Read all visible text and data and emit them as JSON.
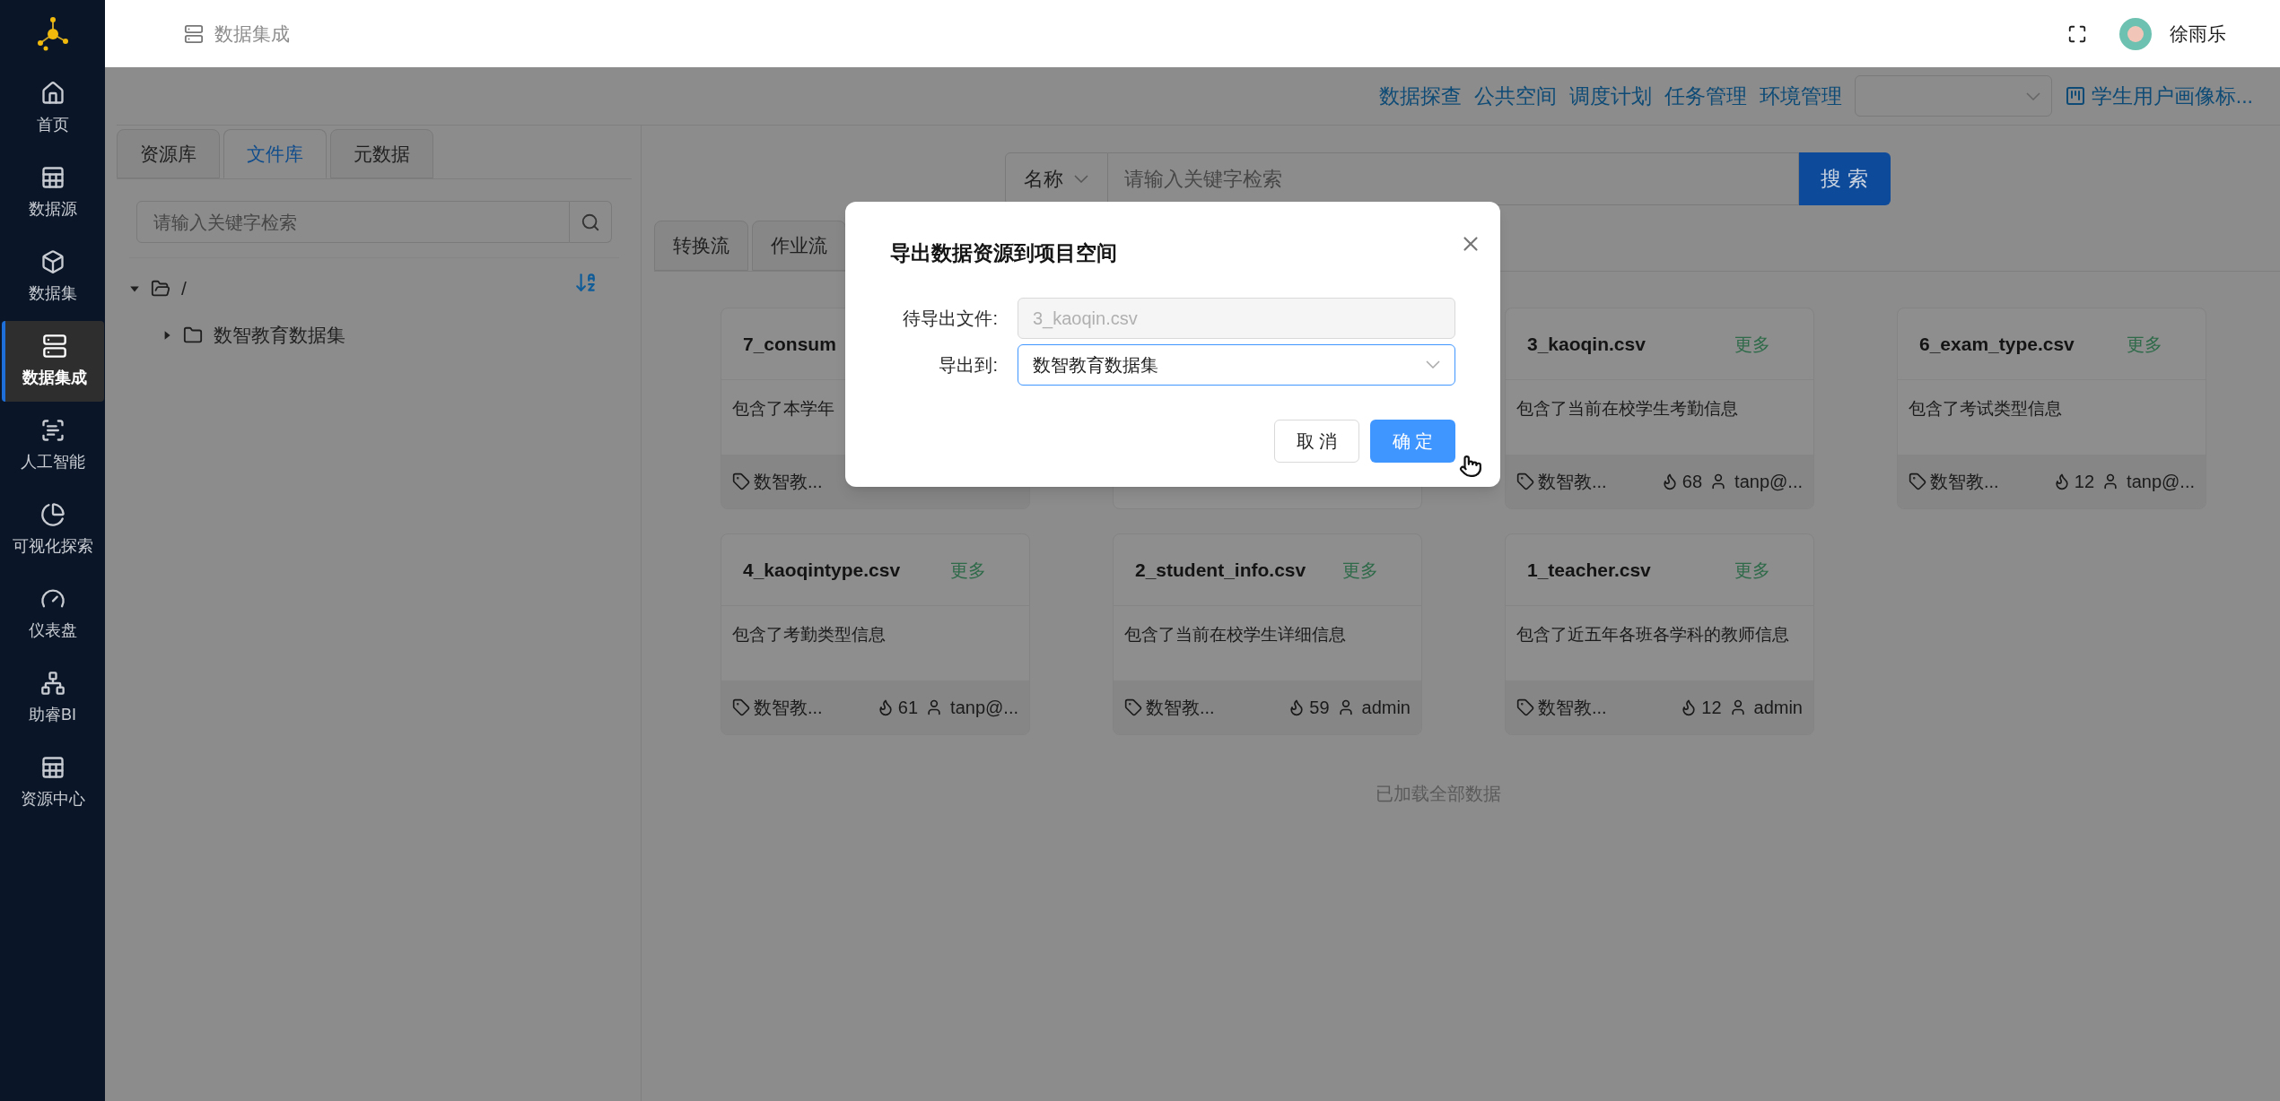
{
  "sidebar": {
    "items": [
      {
        "label": "首页",
        "selected": false
      },
      {
        "label": "数据源",
        "selected": false
      },
      {
        "label": "数据集",
        "selected": false
      },
      {
        "label": "数据集成",
        "selected": true
      },
      {
        "label": "人工智能",
        "selected": false
      },
      {
        "label": "可视化探索",
        "selected": false
      },
      {
        "label": "仪表盘",
        "selected": false
      },
      {
        "label": "助睿BI",
        "selected": false
      },
      {
        "label": "资源中心",
        "selected": false
      }
    ]
  },
  "header": {
    "breadcrumb": "数据集成",
    "user": "徐雨乐"
  },
  "toolbar": {
    "links": [
      "数据探查",
      "公共空间",
      "调度计划",
      "任务管理",
      "环境管理"
    ],
    "project": "学生用户画像标..."
  },
  "left_panel": {
    "tabs": [
      {
        "label": "资源库",
        "selected": false
      },
      {
        "label": "文件库",
        "selected": true
      },
      {
        "label": "元数据",
        "selected": false
      }
    ],
    "search": {
      "placeholder": "请输入关键字检索"
    },
    "tree": [
      {
        "label": "/",
        "expanded": true,
        "children": [
          {
            "label": "数智教育数据集",
            "expanded": false
          }
        ]
      }
    ]
  },
  "search": {
    "field": "名称",
    "placeholder": "请输入关键字检索",
    "button": "搜 索"
  },
  "flow_tabs": [
    {
      "label": "转换流",
      "selected": false
    },
    {
      "label": "作业流",
      "selected": false
    }
  ],
  "cards": [
    {
      "kind": "full",
      "title": "7_consum",
      "description": "包含了本学年",
      "tag": "数智教..."
    },
    {
      "kind": "covered"
    },
    {
      "kind": "full",
      "title": "3_kaoqin.csv",
      "more": "更多",
      "description": "包含了当前在校学生考勤信息",
      "tag": "数智教...",
      "views": "68",
      "owner": "tanp@..."
    },
    {
      "kind": "full",
      "title": "6_exam_type.csv",
      "more": "更多",
      "description": "包含了考试类型信息",
      "tag": "数智教...",
      "views": "12",
      "owner": "tanp@..."
    },
    {
      "kind": "full",
      "title": "4_kaoqintype.csv",
      "more": "更多",
      "description": "包含了考勤类型信息",
      "tag": "数智教...",
      "views": "61",
      "owner": "tanp@..."
    },
    {
      "kind": "full",
      "title": "2_student_info.csv",
      "more": "更多",
      "description": "包含了当前在校学生详细信息",
      "tag": "数智教...",
      "views": "59",
      "owner": "admin"
    },
    {
      "kind": "full",
      "title": "1_teacher.csv",
      "more": "更多",
      "description": "包含了近五年各班各学科的教师信息",
      "tag": "数智教...",
      "views": "12",
      "owner": "admin"
    }
  ],
  "status": "已加载全部数据",
  "dialog": {
    "title": "导出数据资源到项目空间",
    "fields": [
      {
        "kind": "readonly",
        "label": "待导出文件:",
        "value": "3_kaoqin.csv"
      },
      {
        "kind": "select",
        "label": "导出到:",
        "value": "数智教育数据集"
      }
    ],
    "cancel": "取 消",
    "confirm": "确 定"
  }
}
